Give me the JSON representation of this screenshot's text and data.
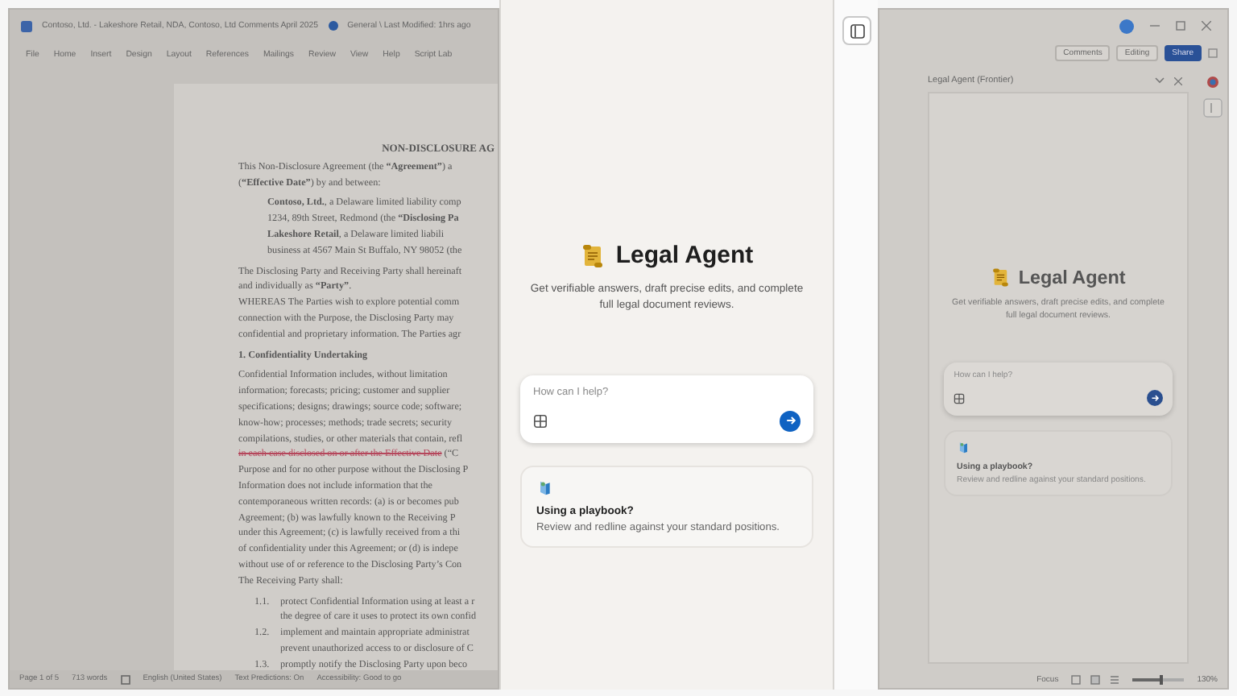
{
  "document_window": {
    "title": "Contoso, Ltd. - Lakeshore Retail, NDA, Contoso, Ltd Comments April 2025",
    "location": "General \\ Last Modified: 1hrs ago",
    "menu": [
      "File",
      "Home",
      "Insert",
      "Design",
      "Layout",
      "References",
      "Mailings",
      "Review",
      "View",
      "Help",
      "Script Lab"
    ],
    "lines": [
      {
        "kind": "heading",
        "text": "NON-DISCLOSURE AG"
      },
      {
        "kind": "body",
        "text": "This Non-Disclosure Agreement (the **“Agreement”**) a"
      },
      {
        "kind": "body",
        "text": "(**“Effective Date”**) by and between:"
      },
      {
        "kind": "indent",
        "text": "**Contoso, Ltd.**, a Delaware limited liability comp"
      },
      {
        "kind": "indent",
        "text": "1234, 89th Street, Redmond (the **“Disclosing Pa**"
      },
      {
        "kind": "indent",
        "text": "**Lakeshore Retail**, a Delaware limited liabili"
      },
      {
        "kind": "indent",
        "text": "business at 4567 Main St Buffalo, NY 98052 (the"
      },
      {
        "kind": "body",
        "text": "The Disclosing Party and Receiving Party shall hereinaft"
      },
      {
        "kind": "body",
        "text": "and individually as **“Party”**."
      },
      {
        "kind": "body",
        "text": "WHEREAS The Parties wish to explore potential comm"
      },
      {
        "kind": "body",
        "text": "connection with the Purpose, the Disclosing Party may"
      },
      {
        "kind": "body",
        "text": "confidential and proprietary information. The Parties agr"
      },
      {
        "kind": "section",
        "text": "1.   Confidentiality Undertaking"
      },
      {
        "kind": "body",
        "text": "Confidential Information includes, without limitation"
      },
      {
        "kind": "body",
        "text": "information; forecasts; pricing; customer and supplier"
      },
      {
        "kind": "body",
        "text": "specifications; designs; drawings; source code; software;"
      },
      {
        "kind": "body",
        "text": "know-how; processes; methods; trade secrets; security"
      },
      {
        "kind": "body",
        "text": "compilations, studies, or other materials that contain, refl"
      },
      {
        "kind": "tracked",
        "deleted": "in each case disclosed on or after the Effective Date",
        "text": " (“C"
      },
      {
        "kind": "body",
        "text": "Purpose and for no other purpose without the Disclosing P"
      },
      {
        "kind": "body",
        "text": "Information does not include information that the"
      },
      {
        "kind": "body",
        "text": "contemporaneous written records: (a) is or becomes pub"
      },
      {
        "kind": "body",
        "text": "Agreement; (b) was lawfully known to the Receiving P"
      },
      {
        "kind": "body",
        "text": "under this Agreement; (c) is lawfully received from a thi"
      },
      {
        "kind": "body",
        "text": "of confidentiality under this Agreement; or (d) is indepe"
      },
      {
        "kind": "body",
        "text": "without use of or reference to the Disclosing Party’s Con"
      },
      {
        "kind": "body",
        "text": "The Receiving Party shall:"
      },
      {
        "kind": "list",
        "number": "1.1.",
        "text": "protect Confidential Information using at least a r"
      },
      {
        "kind": "continuation",
        "text": "the degree of care it uses to protect its own confid"
      },
      {
        "kind": "list",
        "number": "1.2.",
        "text": "implement and maintain appropriate administrat"
      },
      {
        "kind": "continuation",
        "text": "prevent unauthorized access to or disclosure of C"
      },
      {
        "kind": "list",
        "number": "1.3.",
        "text": "promptly notify the Disclosing Party upon beco"
      }
    ],
    "status_bar": [
      "Page 1 of 5",
      "713 words",
      "English (United States)",
      "Text Predictions: On",
      "Accessibility: Good to go"
    ]
  },
  "agent_panel": {
    "title": "Legal Agent",
    "subtitle": "Get verifiable answers, draft precise edits, and complete full legal document reviews.",
    "input": {
      "placeholder": "How can I help?"
    },
    "card": {
      "title": "Using a playbook?",
      "description": "Review and redline against your standard positions."
    }
  },
  "side_window": {
    "ribbon_buttons": [
      {
        "label": "Comments",
        "kind": "outline"
      },
      {
        "label": "Editing",
        "kind": "dropdown"
      },
      {
        "label": "Share",
        "kind": "primary"
      }
    ],
    "pane": {
      "title": "Legal Agent (Frontier)",
      "agent": {
        "title": "Legal Agent",
        "subtitle": "Get verifiable answers, draft precise edits, and complete full legal document reviews.",
        "input": {
          "placeholder": "How can I help?"
        },
        "card": {
          "title": "Using a playbook?",
          "description": "Review and redline against your standard positions."
        }
      }
    },
    "status_bar": {
      "focus": "Focus",
      "zoom": "130%",
      "zoom_slider": {
        "level": 0.55
      }
    }
  }
}
